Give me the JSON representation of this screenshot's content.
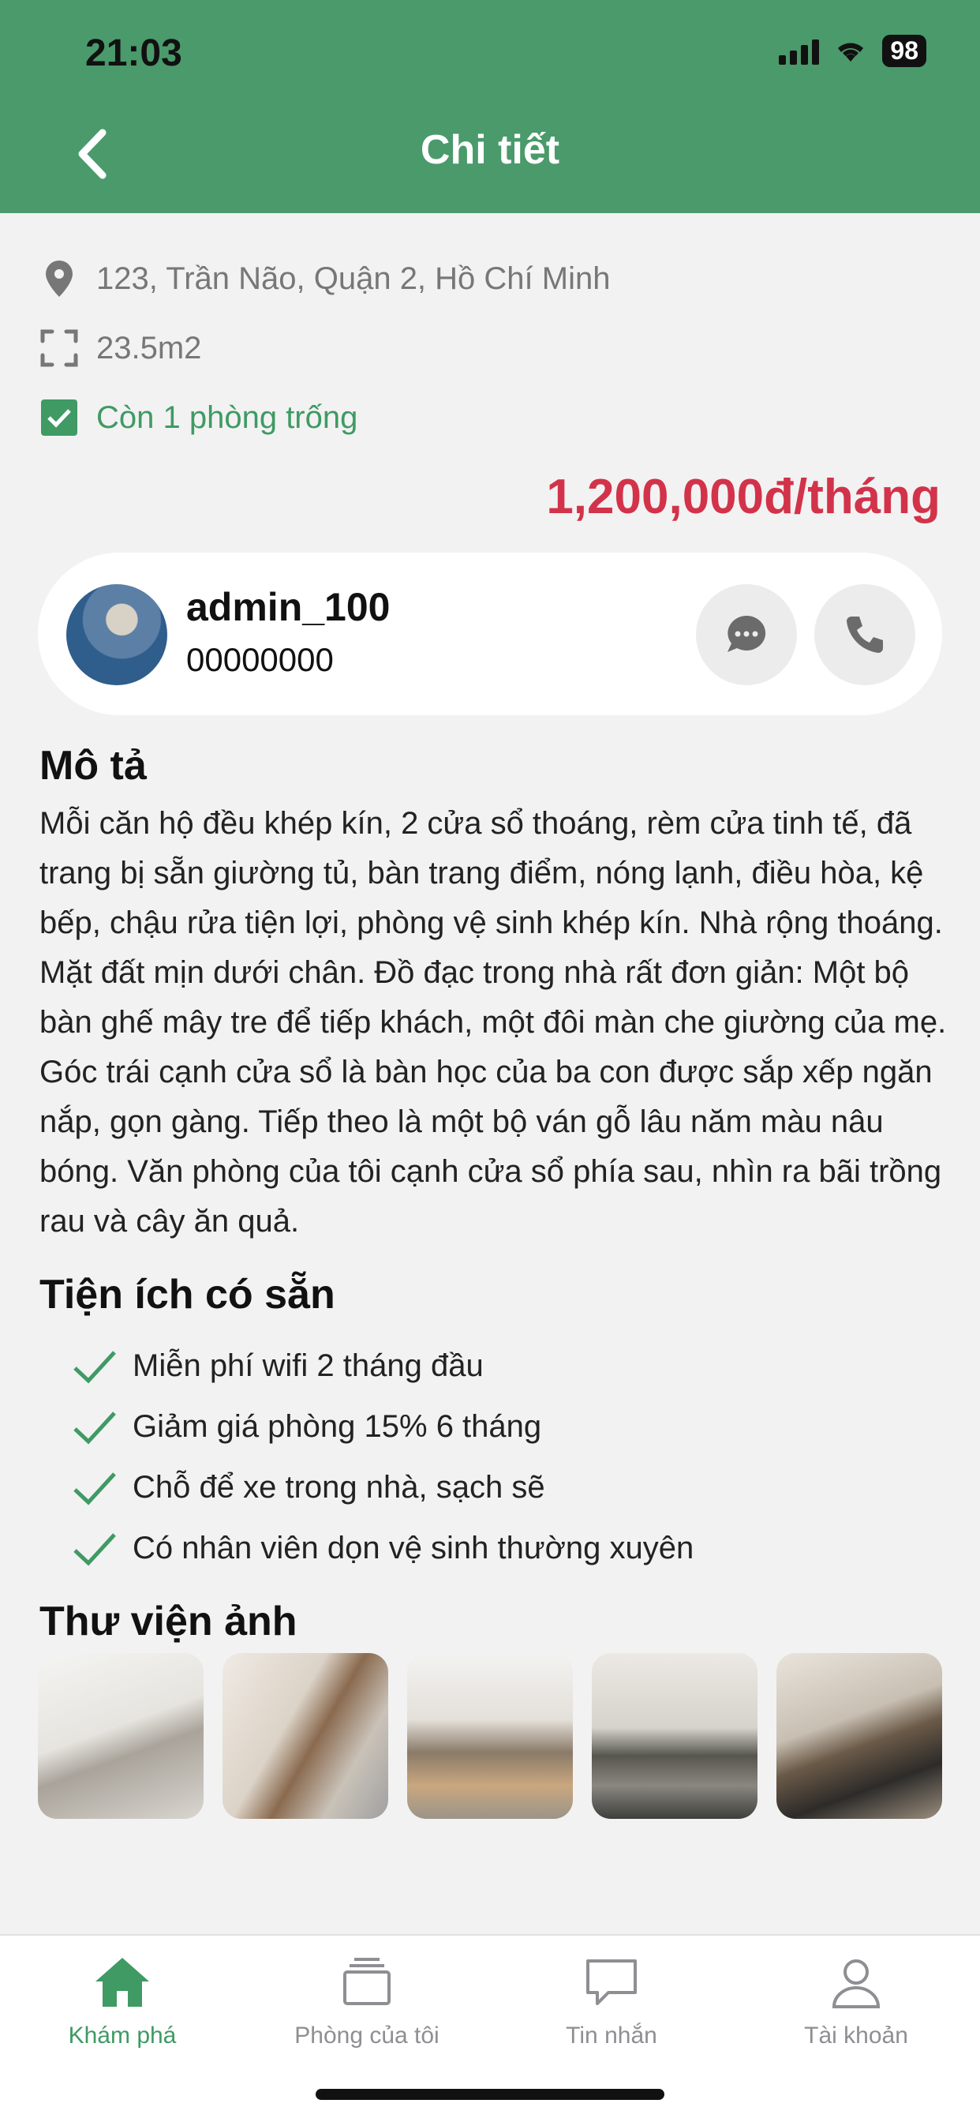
{
  "status_bar": {
    "time": "21:03",
    "battery": "98"
  },
  "header": {
    "title": "Chi tiết"
  },
  "listing": {
    "address": "123, Trần Não, Quận 2, Hồ Chí Minh",
    "area": "23.5m2",
    "availability": "Còn 1 phòng trống",
    "price": "1,200,000đ/tháng"
  },
  "owner": {
    "name": "admin_100",
    "phone": "00000000"
  },
  "description": {
    "title": "Mô tả",
    "text": "Mỗi căn hộ đều khép kín, 2 cửa sổ thoáng, rèm cửa tinh tế, đã trang bị sẵn giường tủ, bàn trang điểm, nóng lạnh, điều hòa, kệ bếp, chậu rửa tiện lợi, phòng vệ sinh khép kín. Nhà rộng thoáng. Mặt đất mịn dưới chân. Đồ đạc trong nhà rất đơn giản: Một bộ bàn ghế mây tre để tiếp khách, một đôi màn che giường của mẹ. Góc trái cạnh cửa sổ là bàn học của ba con được sắp xếp ngăn nắp, gọn gàng. Tiếp theo là một bộ ván gỗ lâu năm màu nâu bóng. Văn phòng của tôi cạnh cửa sổ phía sau, nhìn ra bãi trồng rau và cây ăn quả."
  },
  "amenities": {
    "title": "Tiện ích có sẵn",
    "items": [
      "Miễn phí wifi 2 tháng đầu",
      "Giảm giá phòng 15% 6 tháng",
      "Chỗ để xe trong nhà, sạch sẽ",
      "Có nhân viên dọn vệ sinh thường xuyên"
    ]
  },
  "gallery": {
    "title": "Thư viện ảnh"
  },
  "tabs": [
    {
      "label": "Khám phá",
      "icon": "home-icon",
      "active": true
    },
    {
      "label": "Phòng của tôi",
      "icon": "rooms-icon",
      "active": false
    },
    {
      "label": "Tin nhắn",
      "icon": "chat-bubble-icon",
      "active": false
    },
    {
      "label": "Tài khoản",
      "icon": "user-icon",
      "active": false
    }
  ],
  "colors": {
    "primary": "#4a9a6b",
    "price": "#d2334a",
    "active_tab": "#3f9a64"
  }
}
